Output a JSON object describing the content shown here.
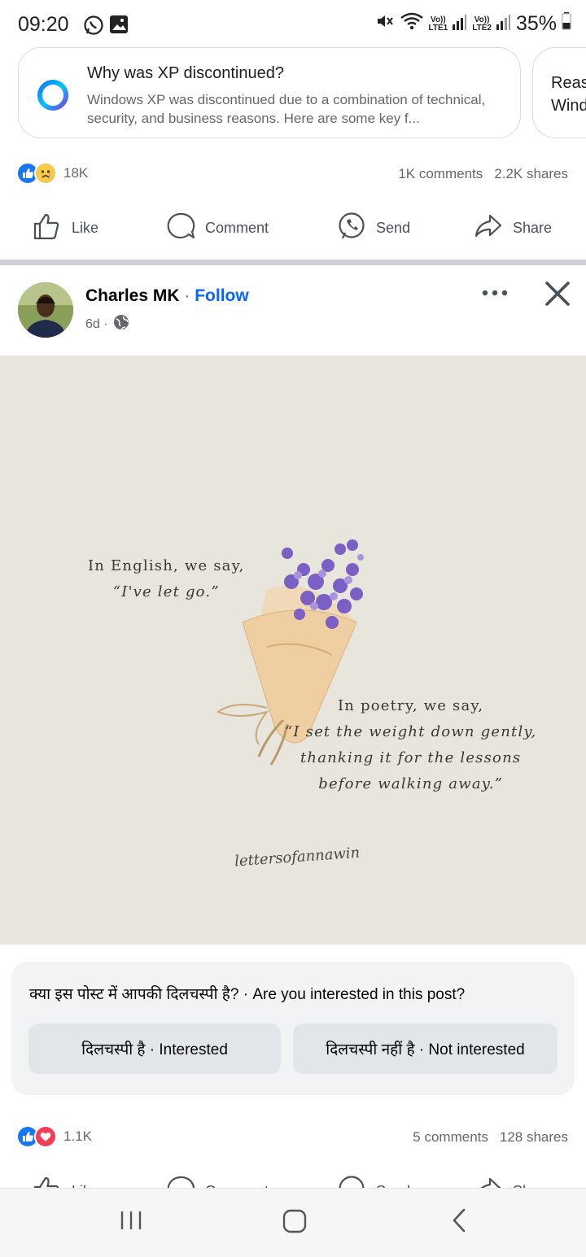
{
  "status_bar": {
    "time": "09:20",
    "lte1_top": "Vo))",
    "lte1_bottom": "LTE1",
    "lte2_top": "Vo))",
    "lte2_bottom": "LTE2",
    "battery": "35%"
  },
  "ai_cards": [
    {
      "title": "Why was XP discontinued?",
      "body": "Windows XP was discontinued due to a combination of technical, security, and business reasons. Here are some key f..."
    },
    {
      "title": "Reas",
      "body": "Wind"
    }
  ],
  "post1": {
    "reaction_count": "18K",
    "comments": "1K comments",
    "shares": "2.2K shares"
  },
  "actions": {
    "like": "Like",
    "comment": "Comment",
    "send": "Send",
    "share": "Share"
  },
  "post2": {
    "author": "Charles MK",
    "separator": "·",
    "follow": "Follow",
    "time": "6d ·",
    "image": {
      "quote1_line1": "In English, we say,",
      "quote1_line2": "“I've let go.”",
      "quote2_line1": "In poetry, we say,",
      "quote2_line2": "“I set the weight down gently,",
      "quote2_line3": "thanking it for the lessons",
      "quote2_line4": "before walking away.”",
      "signature": "lettersofannawin"
    },
    "interest": {
      "question": "क्या इस पोस्ट में आपकी दिलचस्पी है? · Are you interested in this post?",
      "interested": "दिलचस्पी है · Interested",
      "not_interested": "दिलचस्पी नहीं है · Not interested"
    },
    "reaction_count": "1.1K",
    "comments": "5 comments",
    "shares": "128 shares"
  },
  "colors": {
    "accent": "#0866ff",
    "love": "#f33e58",
    "image_bg": "#e7e5dc",
    "lavender": "#7b5fc4"
  }
}
